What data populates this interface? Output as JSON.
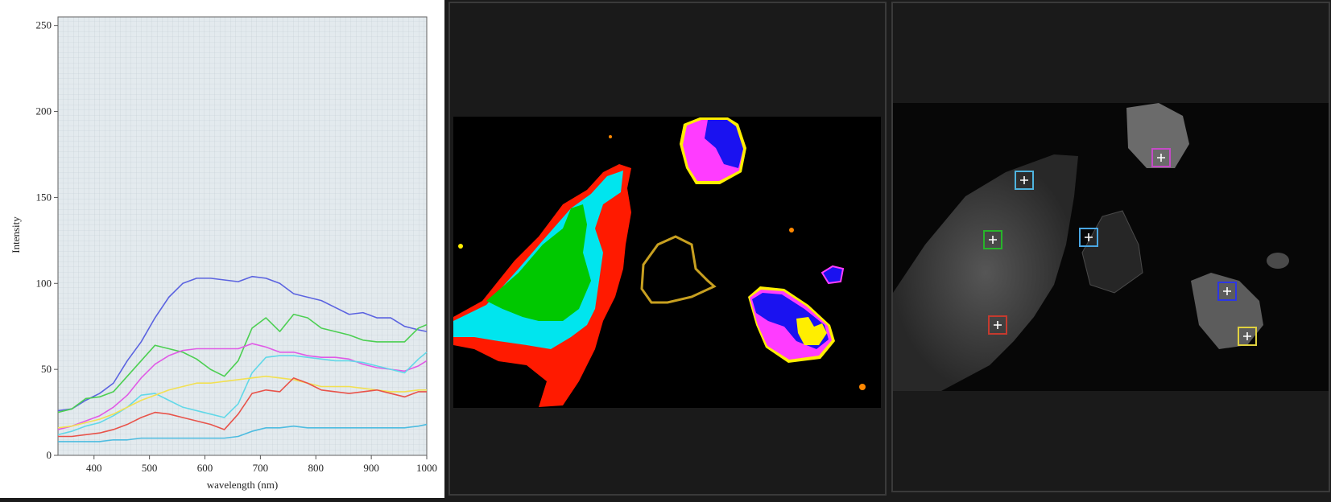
{
  "chart_data": {
    "type": "line",
    "xlabel": "wavelength (nm)",
    "ylabel": "Intensity",
    "xlim": [
      335,
      1000
    ],
    "ylim": [
      0,
      255
    ],
    "xticks": [
      400,
      500,
      600,
      700,
      800,
      900,
      1000
    ],
    "yticks": [
      0,
      50,
      100,
      150,
      200,
      250
    ],
    "grid": true,
    "x": [
      335,
      360,
      385,
      410,
      435,
      460,
      485,
      510,
      535,
      560,
      585,
      610,
      635,
      660,
      685,
      710,
      735,
      760,
      785,
      810,
      835,
      860,
      885,
      910,
      935,
      960,
      985,
      1000
    ],
    "series": [
      {
        "color": "#5b63e0",
        "values": [
          26,
          27,
          32,
          36,
          42,
          55,
          66,
          80,
          92,
          100,
          103,
          103,
          102,
          101,
          104,
          103,
          100,
          94,
          92,
          90,
          86,
          82,
          83,
          80,
          80,
          75,
          73,
          72
        ]
      },
      {
        "color": "#4ccf52",
        "values": [
          25,
          27,
          33,
          34,
          37,
          46,
          55,
          64,
          62,
          60,
          56,
          50,
          46,
          55,
          74,
          80,
          72,
          82,
          80,
          74,
          72,
          70,
          67,
          66,
          66,
          66,
          74,
          76
        ]
      },
      {
        "color": "#e05ae6",
        "values": [
          15,
          17,
          20,
          23,
          28,
          35,
          45,
          53,
          58,
          61,
          62,
          62,
          62,
          62,
          65,
          63,
          60,
          60,
          58,
          57,
          57,
          56,
          53,
          51,
          50,
          49,
          52,
          55
        ]
      },
      {
        "color": "#62d8e8",
        "values": [
          12,
          14,
          17,
          19,
          23,
          28,
          35,
          36,
          32,
          28,
          26,
          24,
          22,
          30,
          48,
          57,
          58,
          58,
          57,
          56,
          55,
          55,
          54,
          52,
          50,
          48,
          56,
          60
        ]
      },
      {
        "color": "#f2e052",
        "values": [
          16,
          17,
          19,
          21,
          24,
          28,
          32,
          35,
          38,
          40,
          42,
          42,
          43,
          44,
          45,
          46,
          45,
          44,
          42,
          40,
          40,
          40,
          39,
          38,
          37,
          37,
          38,
          38
        ]
      },
      {
        "color": "#e8534a",
        "values": [
          11,
          11,
          12,
          13,
          15,
          18,
          22,
          25,
          24,
          22,
          20,
          18,
          15,
          24,
          36,
          38,
          37,
          45,
          42,
          38,
          37,
          36,
          37,
          38,
          36,
          34,
          37,
          37
        ]
      },
      {
        "color": "#4dbce0",
        "values": [
          8,
          8,
          8,
          8,
          9,
          9,
          10,
          10,
          10,
          10,
          10,
          10,
          10,
          11,
          14,
          16,
          16,
          17,
          16,
          16,
          16,
          16,
          16,
          16,
          16,
          16,
          17,
          18
        ]
      }
    ]
  },
  "segmentation_view": {
    "colors": {
      "red": "#ff1a00",
      "cyan": "#00e5ee",
      "green": "#00c800",
      "blue": "#1a12f0",
      "magenta": "#ff3cff",
      "yellow": "#ffee00",
      "background": "#000000"
    }
  },
  "camera_view": {
    "markers": [
      {
        "color": "#4fb4df"
      },
      {
        "color": "#c54ac7"
      },
      {
        "color": "#27b52a"
      },
      {
        "color": "#4aa6e2"
      },
      {
        "color": "#2c36e5"
      },
      {
        "color": "#c53a2e"
      },
      {
        "color": "#e0d13f"
      }
    ]
  }
}
